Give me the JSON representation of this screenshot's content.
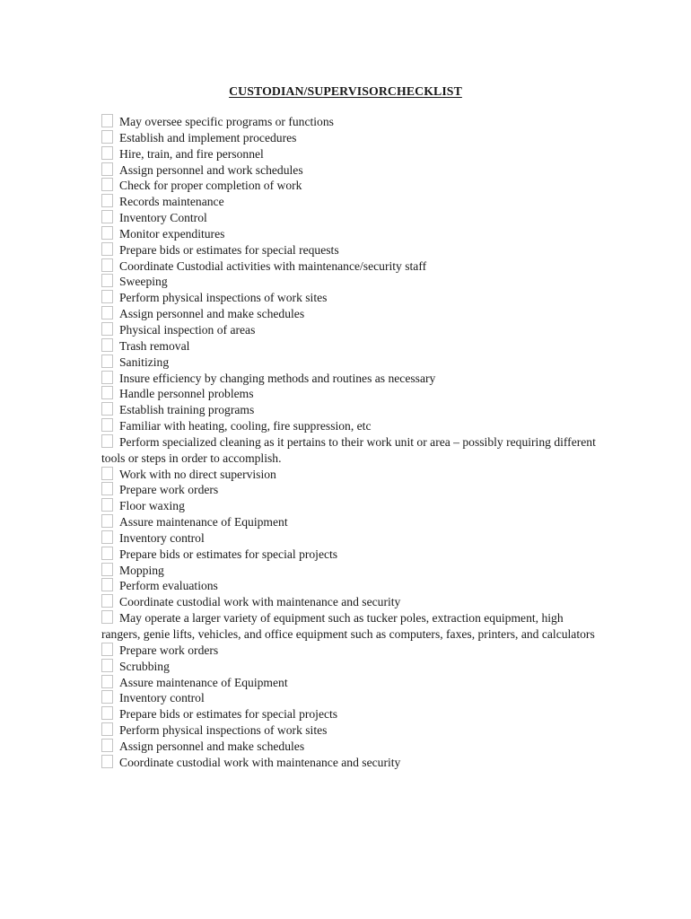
{
  "document": {
    "title": "CUSTODIAN/SUPERVISORCHECKLIST",
    "background_color": "#ffffff",
    "text_color": "#1a1a1a",
    "checkbox_border_color": "#c4c4c4",
    "checkbox_fill_color": "#ffffff"
  },
  "checklist": {
    "items": [
      {
        "checked": false,
        "label": "May oversee specific programs or functions"
      },
      {
        "checked": false,
        "label": "Establish and implement procedures"
      },
      {
        "checked": false,
        "label": "Hire, train, and fire personnel"
      },
      {
        "checked": false,
        "label": "Assign personnel and work schedules"
      },
      {
        "checked": false,
        "label": "Check for proper completion of work"
      },
      {
        "checked": false,
        "label": "Records maintenance"
      },
      {
        "checked": false,
        "label": "Inventory Control"
      },
      {
        "checked": false,
        "label": "Monitor expenditures"
      },
      {
        "checked": false,
        "label": "Prepare bids or estimates for special requests"
      },
      {
        "checked": false,
        "label": "Coordinate Custodial activities with maintenance/security staff"
      },
      {
        "checked": false,
        "label": "Sweeping"
      },
      {
        "checked": false,
        "label": "Perform physical inspections of work sites"
      },
      {
        "checked": false,
        "label": "Assign personnel and make schedules"
      },
      {
        "checked": false,
        "label": "Physical inspection of areas"
      },
      {
        "checked": false,
        "label": "Trash removal"
      },
      {
        "checked": false,
        "label": "Sanitizing"
      },
      {
        "checked": false,
        "label": "Insure efficiency by changing methods and routines as necessary"
      },
      {
        "checked": false,
        "label": "Handle personnel problems"
      },
      {
        "checked": false,
        "label": "Establish training programs"
      },
      {
        "checked": false,
        "label": "Familiar with heating, cooling, fire suppression, etc"
      },
      {
        "checked": false,
        "label": "Perform specialized cleaning as it pertains to their work unit or area – possibly requiring different tools or steps in order to accomplish."
      },
      {
        "checked": false,
        "label": "Work with no direct supervision"
      },
      {
        "checked": false,
        "label": "Prepare work orders"
      },
      {
        "checked": false,
        "label": "Floor waxing"
      },
      {
        "checked": false,
        "label": "Assure maintenance of Equipment"
      },
      {
        "checked": false,
        "label": "Inventory control"
      },
      {
        "checked": false,
        "label": "Prepare bids or estimates for special projects"
      },
      {
        "checked": false,
        "label": "Mopping"
      },
      {
        "checked": false,
        "label": "Perform evaluations"
      },
      {
        "checked": false,
        "label": "Coordinate custodial work with maintenance and security"
      },
      {
        "checked": false,
        "label": "May operate a larger variety of equipment such as tucker poles, extraction equipment, high rangers, genie lifts, vehicles, and office equipment such as computers, faxes, printers, and calculators"
      },
      {
        "checked": false,
        "label": "Prepare work orders"
      },
      {
        "checked": false,
        "label": "Scrubbing"
      },
      {
        "checked": false,
        "label": "Assure maintenance of Equipment"
      },
      {
        "checked": false,
        "label": "Inventory control"
      },
      {
        "checked": false,
        "label": "Prepare bids or estimates for special projects"
      },
      {
        "checked": false,
        "label": "Perform physical inspections of work sites"
      },
      {
        "checked": false,
        "label": "Assign personnel and make schedules"
      },
      {
        "checked": false,
        "label": "Coordinate custodial work with maintenance and security"
      }
    ]
  }
}
